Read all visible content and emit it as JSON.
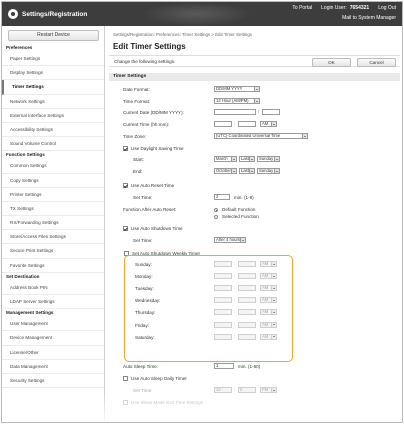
{
  "header": {
    "title": "Settings/Registration",
    "links": [
      "To Portal",
      "Login User:",
      "7654321",
      "Log Out"
    ],
    "mail_link": "Mail to System Manager"
  },
  "sidebar": {
    "restart_label": "Restart Device",
    "sections": [
      {
        "heading": "Preferences",
        "items": [
          "Paper Settings",
          "Display Settings",
          "Timer Settings",
          "Network Settings",
          "External Interface Settings",
          "Accessibility Settings",
          "Sound Volume Control"
        ]
      },
      {
        "heading": "Function Settings",
        "items": [
          "Common Settings",
          "Copy Settings",
          "Printer Settings",
          "TX Settings",
          "RX/Forwarding Settings",
          "Store/Access Files Settings",
          "Secure Print Settings",
          "Favorite Settings"
        ]
      },
      {
        "heading": "Set Destination",
        "items": [
          "Address Book PIN",
          "LDAP Server Settings"
        ]
      },
      {
        "heading": "Management Settings",
        "items": [
          "User Management",
          "Device Management",
          "License/Other",
          "Data Management",
          "Security Settings"
        ]
      }
    ],
    "active_item": "Timer Settings"
  },
  "main": {
    "breadcrumb": "Settings/Registration: Preferences: Timer Settings > Edit Timer Settings",
    "title": "Edit Timer Settings",
    "description": "Change the following settings.",
    "ok_label": "OK",
    "cancel_label": "Cancel",
    "section_title": "Timer Settings",
    "date_format": {
      "label": "Date Format:",
      "value": "DD/MM YYYY"
    },
    "time_format": {
      "label": "Time Format:",
      "value": "12 Hour (AM/PM)"
    },
    "current_date": {
      "label": "Current Date (DD/MM YYYY):",
      "separator": "/"
    },
    "current_time": {
      "label": "Current Time (hh:mm):",
      "separator": ":",
      "ampm": "AM"
    },
    "time_zone": {
      "label": "Time Zone:",
      "value": "(UTC) Coordinated Universal Time"
    },
    "daylight": {
      "label": "Use Daylight Saving Time",
      "start_label": "Start:",
      "start": [
        "March",
        "Last",
        "Sunday"
      ],
      "end_label": "End:",
      "end": [
        "October",
        "Last",
        "Sunday"
      ]
    },
    "auto_reset": {
      "label": "Use Auto Reset Time",
      "set_time_label": "Set Time:",
      "value": "2",
      "unit": "min. (1-9)"
    },
    "after_reset": {
      "label": "Function After Auto Reset:",
      "option1": "Default Function",
      "option2": "Selected Function"
    },
    "auto_shutdown": {
      "label": "Use Auto Shutdown Time",
      "set_time_label": "Set Time:",
      "value": "After 4 hours"
    },
    "weekly_timer": {
      "label": "Set Auto Shutdown Weekly Timer",
      "days": [
        "Sunday:",
        "Monday:",
        "Tuesday:",
        "Wednesday:",
        "Thursday:",
        "Friday:",
        "Saturday:"
      ],
      "separator": ":",
      "ampm": "AM"
    },
    "auto_sleep": {
      "label": "Auto Sleep Time:",
      "value": "1",
      "unit": "min. (1-60)"
    },
    "sleep_daily": {
      "label": "Use Auto Sleep Daily Timer",
      "set_time_label": "Set Time:",
      "hour": "12",
      "minute": "0",
      "ampm": "PM"
    },
    "sleep_mode_exit": {
      "label": "Use Sleep Mode Exit Time Settings"
    }
  },
  "colors": {
    "topbar": "#3d3d3d",
    "highlight": "#f0a431"
  }
}
